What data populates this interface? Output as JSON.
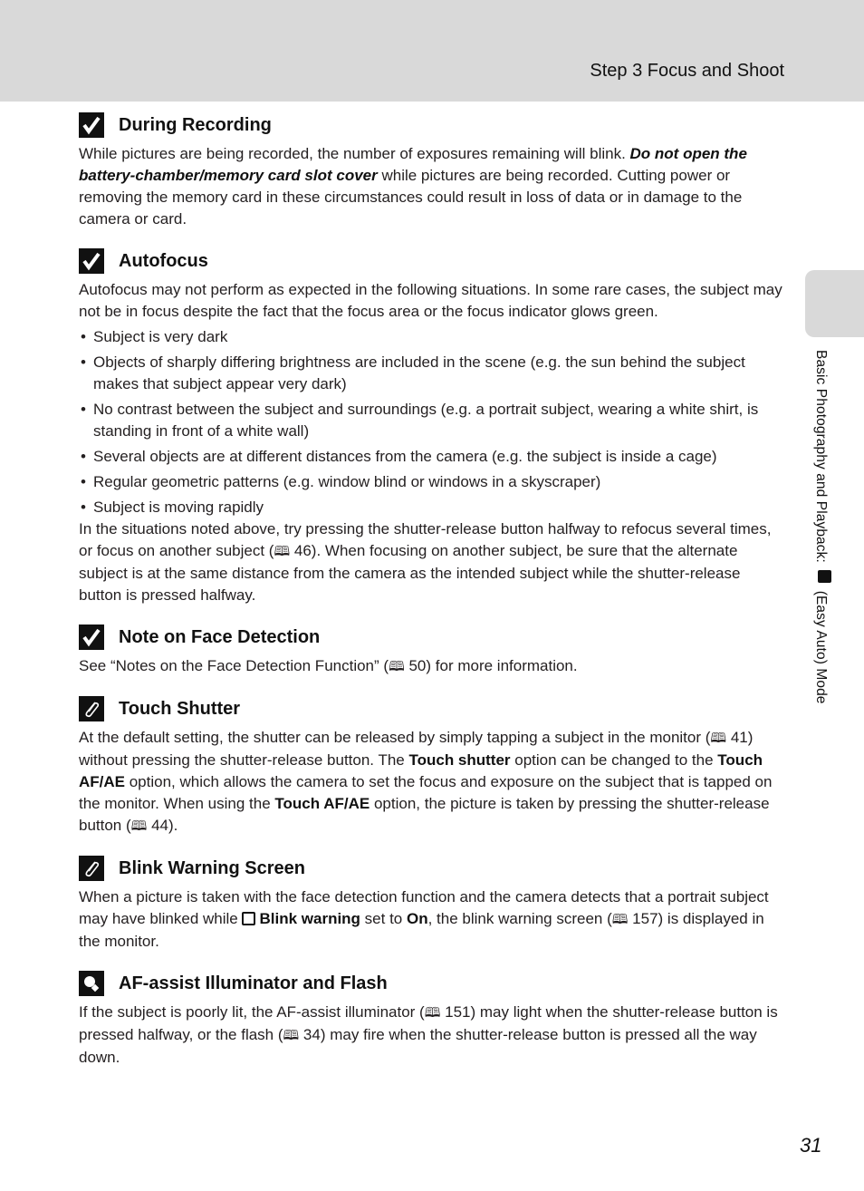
{
  "header": {
    "title": "Step 3 Focus and Shoot"
  },
  "side_tab": {
    "text_before": "Basic Photography and Playback:",
    "text_after": "(Easy Auto) Mode",
    "icon": "easy-auto-camera-icon"
  },
  "page_number": "31",
  "book_ref_icon": "🕮",
  "sections": {
    "during_recording": {
      "icon": "check-icon",
      "title": "During Recording",
      "p1_a": "While pictures are being recorded, the number of exposures remaining will blink. ",
      "p1_bold": "Do not open the battery-chamber/memory card slot cover",
      "p1_b": " while pictures are being recorded. Cutting power or removing the memory card in these circumstances could result in loss of data or in damage to the camera or card."
    },
    "autofocus": {
      "icon": "check-icon",
      "title": "Autofocus",
      "intro": "Autofocus may not perform as expected in the following situations. In some rare cases, the subject may not be in focus despite the fact that the focus area or the focus indicator glows green.",
      "bullets": [
        "Subject is very dark",
        "Objects of sharply differing brightness are included in the scene (e.g. the sun behind the subject makes that subject appear very dark)",
        "No contrast between the subject and surroundings (e.g. a portrait subject, wearing a white shirt, is standing in front of a white wall)",
        "Several objects are at different distances from the camera (e.g. the subject is inside a cage)",
        "Regular geometric patterns (e.g. window blind or windows in a skyscraper)",
        "Subject is moving rapidly"
      ],
      "outro_a": "In the situations noted above, try pressing the shutter-release button halfway to refocus several times, or focus on another subject (",
      "outro_ref": " 46",
      "outro_b": "). When focusing on another subject, be sure that the alternate subject is at the same distance from the camera as the intended subject while the shutter-release button is pressed halfway."
    },
    "face_detection": {
      "icon": "check-icon",
      "title": "Note on Face Detection",
      "text_a": "See “Notes on the Face Detection Function” (",
      "ref": " 50",
      "text_b": ") for more information."
    },
    "touch_shutter": {
      "icon": "paperclip-icon",
      "title": "Touch Shutter",
      "t1": "At the default setting, the shutter can be released by simply tapping a subject in the monitor (",
      "ref1": " 41",
      "t2": ") without pressing the shutter-release button. The ",
      "b1": "Touch shutter",
      "t3": " option can be changed to the ",
      "b2": "Touch AF/AE",
      "t4": " option, which allows the camera to set the focus and exposure on the subject that is tapped on the monitor. When using the ",
      "b3": "Touch AF/AE",
      "t5": " option, the picture is taken by pressing the shutter-release button (",
      "ref2": " 44",
      "t6": ")."
    },
    "blink_warning": {
      "icon": "paperclip-icon",
      "title": "Blink Warning Screen",
      "t1": "When a picture is taken with the face detection function and the camera detects that a portrait subject may have blinked while ",
      "b1": "Blink warning",
      "t2": " set to ",
      "b2": "On",
      "t3": ", the blink warning screen (",
      "ref": " 157",
      "t4": ") is displayed in the monitor."
    },
    "af_assist": {
      "icon": "lightbulb-icon",
      "title": "AF-assist Illuminator and Flash",
      "t1": "If the subject is poorly lit, the AF-assist illuminator (",
      "ref1": " 151",
      "t2": ") may light when the shutter-release button is pressed halfway, or the flash (",
      "ref2": " 34",
      "t3": ") may fire when the shutter-release button is pressed all the way down."
    }
  }
}
